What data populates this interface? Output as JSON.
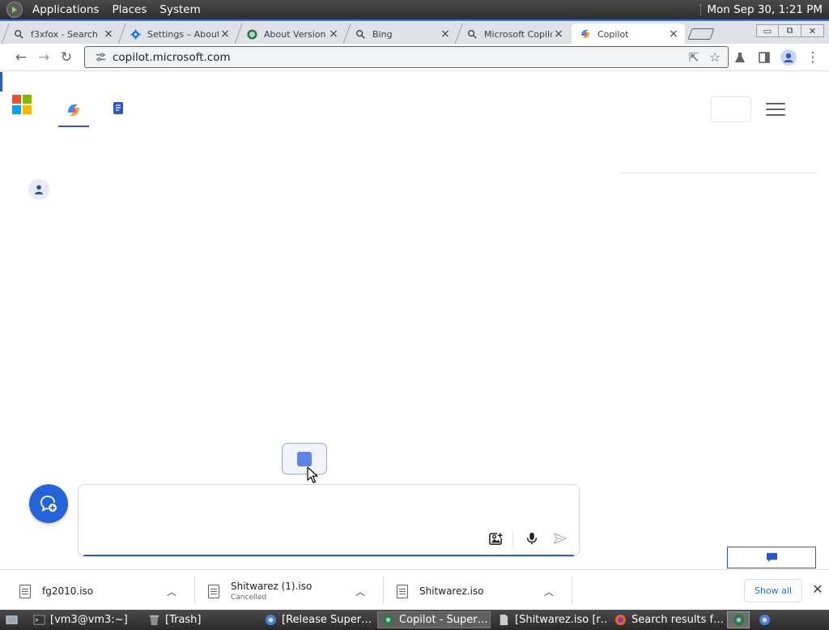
{
  "top_panel": {
    "menus": [
      "Applications",
      "Places",
      "System"
    ],
    "clock": "Mon Sep 30,  1:21 PM"
  },
  "tabs": [
    {
      "title": "f3xfox - Search",
      "icon": "search-icon",
      "close": "×"
    },
    {
      "title": "Settings – About",
      "icon": "gear-icon",
      "close": "×"
    },
    {
      "title": "About Version",
      "icon": "chromium-icon",
      "close": "×"
    },
    {
      "title": "Bing",
      "icon": "search-icon",
      "close": "×"
    },
    {
      "title": "Microsoft Copilot",
      "icon": "search-icon",
      "close": "×"
    },
    {
      "title": "Copilot",
      "icon": "copilot-icon",
      "close": "×",
      "active": true
    }
  ],
  "window_buttons": {
    "minimize": "▭",
    "restore": "⧉",
    "close": "✕"
  },
  "toolbar": {
    "back": "←",
    "forward": "→",
    "reload": "↻",
    "url": "copilot.microsoft.com",
    "share": "⇱",
    "bookmark": "☆",
    "menu": "⋮"
  },
  "colors": {
    "accent": "#2b57c8",
    "ms_red": "#f25022",
    "ms_green": "#7fba00",
    "ms_blue": "#00a4ef",
    "ms_yellow": "#ffb900",
    "copilot_button": "#2563d9"
  },
  "composer": {
    "value": "",
    "placeholder": ""
  },
  "downloads": [
    {
      "name": "fg2010.iso",
      "status": ""
    },
    {
      "name": "Shitwarez (1).iso",
      "status": "Cancelled"
    },
    {
      "name": "Shitwarez.iso",
      "status": ""
    }
  ],
  "downloads_show_all": "Show all",
  "downloads_close": "✕",
  "taskbar": {
    "tasks": [
      {
        "label": "[vm3@vm3:~]",
        "icon": "terminal-icon"
      },
      {
        "label": "[Trash]",
        "icon": "trash-icon"
      },
      {
        "label": "[Release Super…",
        "icon": "chrome-icon"
      },
      {
        "label": "Copilot - Super…",
        "icon": "chromium-icon",
        "active": true
      },
      {
        "label": "[Shitwarez.iso [r…",
        "icon": "file-icon"
      },
      {
        "label": "Search results f…",
        "icon": "firefox-icon"
      }
    ]
  }
}
